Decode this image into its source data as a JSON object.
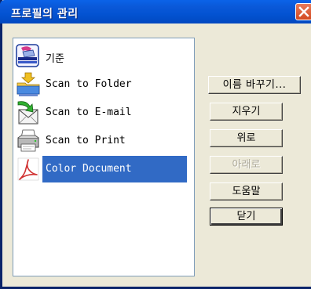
{
  "window": {
    "title": "프로필의 관리"
  },
  "profiles": [
    {
      "label": "기준",
      "icon": "organizer-icon",
      "selected": false
    },
    {
      "label": "Scan to Folder",
      "icon": "folder-scan-icon",
      "selected": false
    },
    {
      "label": "Scan to E-mail",
      "icon": "email-scan-icon",
      "selected": false
    },
    {
      "label": "Scan to Print",
      "icon": "printer-icon",
      "selected": false
    },
    {
      "label": "Color Document",
      "icon": "pdf-document-icon",
      "selected": true
    }
  ],
  "buttons": {
    "rename": "이름 바꾸기...",
    "delete": "지우기",
    "up": "위로",
    "down": "아래로",
    "help": "도움말",
    "close": "닫기"
  },
  "colors": {
    "titlebar": "#0353d2",
    "selection": "#316ac5",
    "face": "#ece9d8"
  }
}
